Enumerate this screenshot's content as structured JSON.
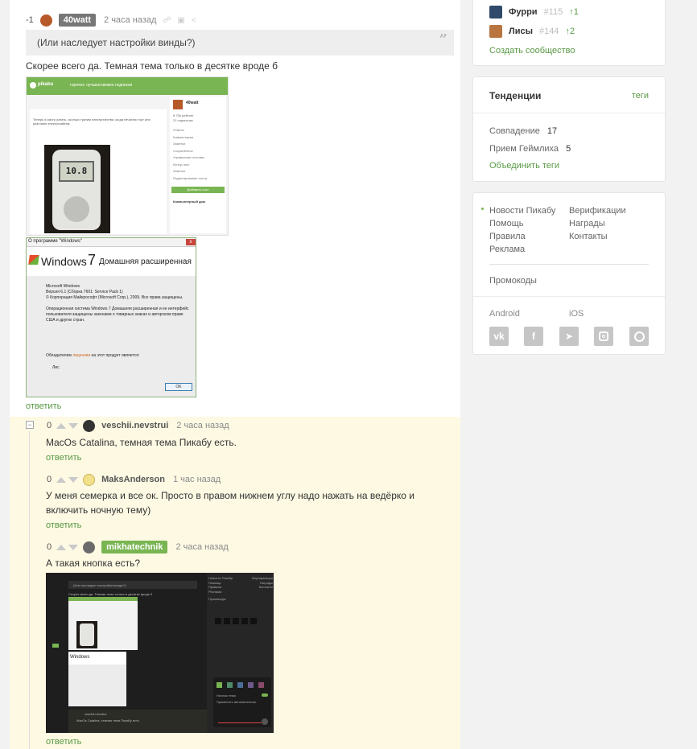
{
  "comment_top": {
    "rating": "-1",
    "user": "40watt",
    "time": "2 часа назад",
    "quote": "(Или наследует настройки винды?)",
    "text": "Скорее всего да. Темная тема только в десятке вроде б",
    "reply": "ответить"
  },
  "screenshot_pikabu": {
    "logo": "pikabu",
    "nav": [
      "горячее",
      "лучшее",
      "свежее",
      "подписки"
    ],
    "author": "40watt",
    "stats": [
      "8 756 рейтинг",
      "21 подписчик"
    ],
    "menu": [
      "Ответы",
      "Комментарии",
      "Заметки",
      "Сохранённое",
      "Управление постами",
      "Игнор-лист",
      "Заметки",
      "Редактирование поста"
    ],
    "add_button": "Добавить пост",
    "post_text": "Теперь я смогу узнать, сколько тратим электричества, когда печатаю торт или разгоняю электрочайник",
    "meter": "10.8",
    "community": "Компьютерный дом"
  },
  "screenshot_windows": {
    "title": "О программе \"Windows\"",
    "brand": "Windows",
    "version": "7",
    "edition": "Домашняя расширенная",
    "lines": [
      "Microsoft Windows",
      "Версия 6.1 (Сборка 7601: Service Pack 1)",
      "© Корпорация Майкрософт (Microsoft Corp.), 2009. Все права защищены.",
      "Операционная система Windows 7 Домашняя расширенная и ее интерфейс",
      "пользователя защищены законами о товарных знаках и авторском праве",
      "США и других стран."
    ],
    "license_prefix": "Обладателем",
    "license_link": "лицензии",
    "license_suffix": "на этот продукт является:",
    "owner": "Лис",
    "ok": "OK"
  },
  "replies": [
    {
      "rating": "0",
      "user": "veschii.nevstrui",
      "time": "2 часа назад",
      "text": "MacOs Catalina, темная тема Пикабу есть.",
      "reply": "ответить"
    },
    {
      "rating": "0",
      "user": "MaksAnderson",
      "time": "1 час назад",
      "text": "У меня семерка и все ок. Просто в правом нижнем углу надо нажать на ведёрко и включить ночную тему)",
      "reply": "ответить"
    },
    {
      "rating": "0",
      "user": "mikhatechnik",
      "time": "2 часа назад",
      "text": "А такая кнопка есть?",
      "reply": "ответить"
    }
  ],
  "collapse_symbol": "−",
  "screenshot_dark": {
    "quote": "(Или наследует настройки винды?)",
    "text": "Скорее всего да. Темная тема только в десятке вроде б",
    "footer": [
      {
        "left": "Новости Пикабу",
        "right": "Верификации"
      },
      {
        "left": "Помощь",
        "right": "Награды"
      },
      {
        "left": "Правила",
        "right": "Контакты"
      },
      {
        "left": "Реклама",
        "right": ""
      }
    ],
    "promo": "Промокоды",
    "night_mode": "Ночная тема",
    "auto_label": "Применить автоматически",
    "reply_user": "veschii.nevstrui",
    "reply_text": "MacOs Catalina, темная тема Пикабу есть."
  },
  "sidebar": {
    "communities": [
      {
        "name": "Фурри",
        "rank": "#115",
        "delta": "1"
      },
      {
        "name": "Лисы",
        "rank": "#144",
        "delta": "2"
      }
    ],
    "create_community": "Создать сообщество",
    "trends_title": "Тенденции",
    "tags_link": "теги",
    "trends": [
      {
        "name": "Совпадение",
        "count": "17"
      },
      {
        "name": "Прием Геймлиха",
        "count": "5"
      }
    ],
    "merge_tags": "Объединить теги",
    "links": [
      {
        "left": "Новости Пикабу",
        "right": "Верификации"
      },
      {
        "left": "Помощь",
        "right": "Награды"
      },
      {
        "left": "Правила",
        "right": "Контакты"
      },
      {
        "left": "Реклама",
        "right": ""
      }
    ],
    "promo": "Промокоды",
    "apps": [
      "Android",
      "iOS"
    ],
    "social": [
      "vk-icon",
      "facebook-icon",
      "telegram-icon",
      "instagram-icon",
      "viber-icon"
    ]
  },
  "colors": {
    "accent": "#589944",
    "highlight": "#fdf9e3",
    "badge": "#777777"
  }
}
